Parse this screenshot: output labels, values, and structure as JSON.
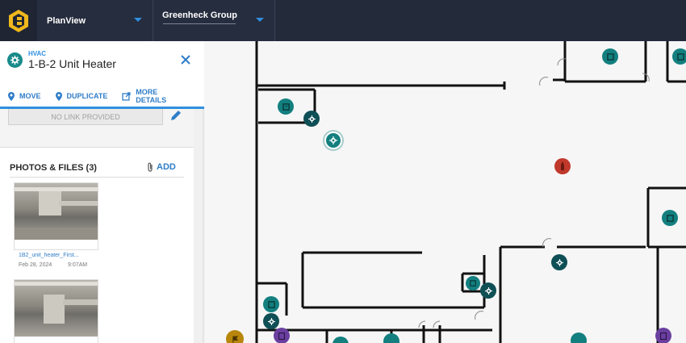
{
  "topbar": {
    "logo_icon": "hexagon-logo-icon",
    "app_selector": {
      "label": "PlanView"
    },
    "org_selector": {
      "label": "Greenheck Group"
    },
    "accent": "#2f8fe0"
  },
  "panel": {
    "category": "HVAC",
    "title": "1-B-2 Unit Heater",
    "actions": {
      "move": "MOVE",
      "duplicate": "DUPLICATE",
      "more_details": "MORE DETAILS"
    },
    "link": {
      "value": "NO LINK PROVIDED"
    },
    "photos": {
      "header": "PHOTOS & FILES (3)",
      "add_label": "ADD",
      "files": [
        {
          "name": "1B2_unit_heater_First...",
          "date": "Feb 28, 2024",
          "time": "9:07AM"
        }
      ]
    }
  },
  "colors": {
    "hvac_marker": "#137f7f",
    "fire_marker": "#c0392b",
    "electrical_marker": "#6a3fa0",
    "gas_marker": "#b8860b"
  }
}
